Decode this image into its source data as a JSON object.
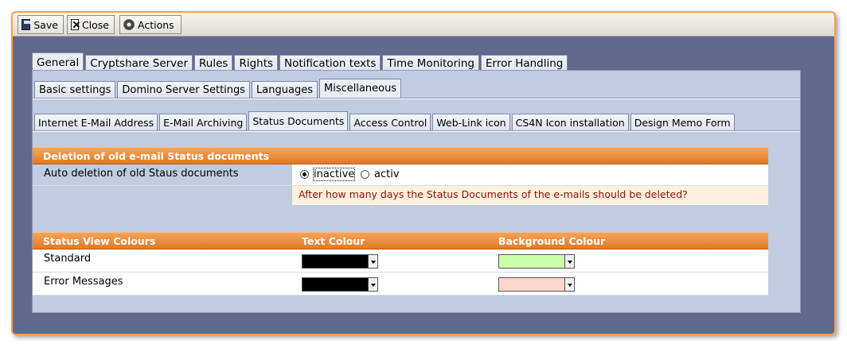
{
  "toolbar": {
    "save_label": "Save",
    "close_label": "Close",
    "actions_label": "Actions"
  },
  "tabs_main": [
    "General",
    "Cryptshare Server",
    "Rules",
    "Rights",
    "Notification texts",
    "Time Monitoring",
    "Error Handling"
  ],
  "tabs_sub": [
    "Basic settings",
    "Domino Server Settings",
    "Languages",
    "Miscellaneous"
  ],
  "tabs_sub2": [
    "Internet E-Mail Address",
    "E-Mail Archiving",
    "Status Documents",
    "Access Control",
    "Web-Link icon",
    "CS4N Icon installation",
    "Design Memo Form"
  ],
  "deletion": {
    "header": "Deletion of old e-mail Status documents",
    "auto_label": "Auto deletion of old Staus documents",
    "option_inactive": "inactive",
    "option_activ": "activ",
    "selected": "inactive",
    "info_text": "After how many days the Status Documents of the e-mails should be deleted?"
  },
  "colours": {
    "header_col1": "Status View Colours",
    "header_col2": "Text Colour",
    "header_col3": "Background Colour",
    "rows": [
      {
        "label": "Standard",
        "text_colour": "#000000",
        "bg_colour": "#ccffaa"
      },
      {
        "label": "Error Messages",
        "text_colour": "#000000",
        "bg_colour": "#ffd6cc"
      }
    ]
  },
  "theme": {
    "accent": "#e88a3a",
    "frame_bg": "#5f6a8c",
    "panel_bg": "#c0ccdf"
  }
}
